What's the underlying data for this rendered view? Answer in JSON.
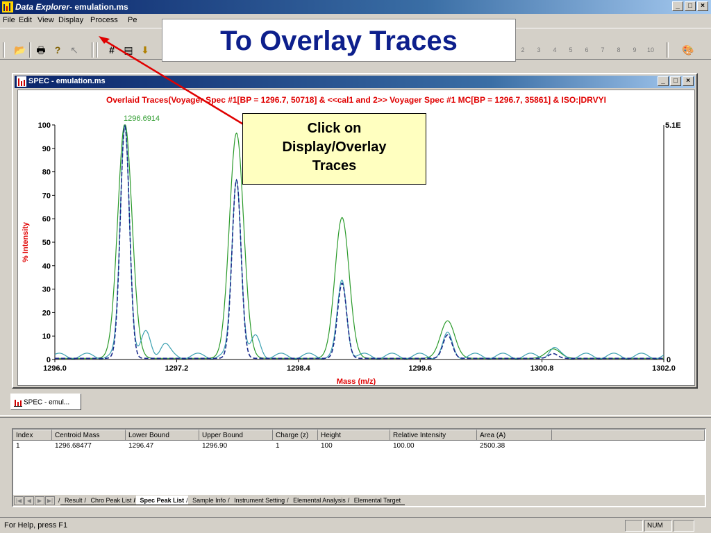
{
  "window": {
    "app_name": "Data Explorer",
    "doc": "- emulation.ms",
    "btn_min": "_",
    "btn_max": "□",
    "btn_close": "×"
  },
  "menu": [
    "File",
    "Edit",
    "View",
    "Display",
    "Process",
    "Pe"
  ],
  "toolbar": {
    "icons": [
      "open-folder-icon",
      "print-icon",
      "help-icon",
      "context-help-icon",
      "grid-icon",
      "document-icon",
      "download-icon",
      "color-palette-icon"
    ],
    "trace_buttons": [
      "2",
      "3",
      "4",
      "5",
      "6",
      "7",
      "8",
      "9",
      "10"
    ]
  },
  "banner": "To Overlay Traces",
  "callout": {
    "line1": "Click on",
    "line2": "Display/Overlay",
    "line3": "Traces"
  },
  "spec_window": {
    "title": "SPEC - emulation.ms"
  },
  "chart_data": {
    "type": "line",
    "title": "Overlaid Traces(Voyager Spec #1[BP = 1296.7, 50718] & <<cal1 and 2>> Voyager Spec #1 MC[BP = 1296.7, 35861] & ISO:|DRVYI",
    "xlabel": "Mass (m/z)",
    "ylabel": "% Intensity",
    "xlim": [
      1296.0,
      1302.0
    ],
    "ylim": [
      0,
      100
    ],
    "x_ticks": [
      "1296.0",
      "1297.2",
      "1298.4",
      "1299.6",
      "1300.8",
      "1302.0"
    ],
    "y_ticks": [
      "0",
      "10",
      "20",
      "30",
      "40",
      "50",
      "60",
      "70",
      "80",
      "90",
      "100"
    ],
    "right_axis_labels": {
      "top": "5.1E",
      "bottom": "0"
    },
    "annotation": {
      "x": 1296.6914,
      "text": "1296.6914"
    },
    "series": [
      {
        "color": "#2a9a2a",
        "peaks": [
          [
            1296.69,
            100
          ],
          [
            1297.79,
            96
          ],
          [
            1298.83,
            60
          ],
          [
            1299.87,
            16
          ],
          [
            1300.91,
            4
          ]
        ]
      },
      {
        "color": "#3aa0b0",
        "peaks": [
          [
            1296.69,
            99
          ],
          [
            1296.9,
            10
          ],
          [
            1297.08,
            5
          ],
          [
            1297.79,
            76
          ],
          [
            1297.98,
            8
          ],
          [
            1298.83,
            32
          ],
          [
            1299.87,
            9
          ],
          [
            1300.91,
            3
          ]
        ]
      },
      {
        "color": "#1a2a8a",
        "peaks": [
          [
            1296.69,
            99
          ],
          [
            1297.79,
            76
          ],
          [
            1298.83,
            32
          ],
          [
            1299.87,
            10
          ],
          [
            1300.91,
            2
          ]
        ]
      }
    ]
  },
  "doc_tab": "SPEC - emul...",
  "peak_table": {
    "headers": [
      "Index",
      "Centroid Mass",
      "Lower Bound",
      "Upper Bound",
      "Charge (z)",
      "Height",
      "Relative Intensity",
      "Area (A)"
    ],
    "rows": [
      [
        "1",
        "1296.68477",
        "1296.47",
        "1296.90",
        "1",
        "100",
        "100.00",
        "2500.38"
      ]
    ],
    "tabs": [
      "Result",
      "Chro Peak List",
      "Spec Peak List",
      "Sample Info",
      "Instrument Setting",
      "Elemental Analysis",
      "Elemental Target"
    ],
    "active_tab": "Spec Peak List"
  },
  "status": {
    "message": "For Help, press F1",
    "num": "NUM"
  }
}
